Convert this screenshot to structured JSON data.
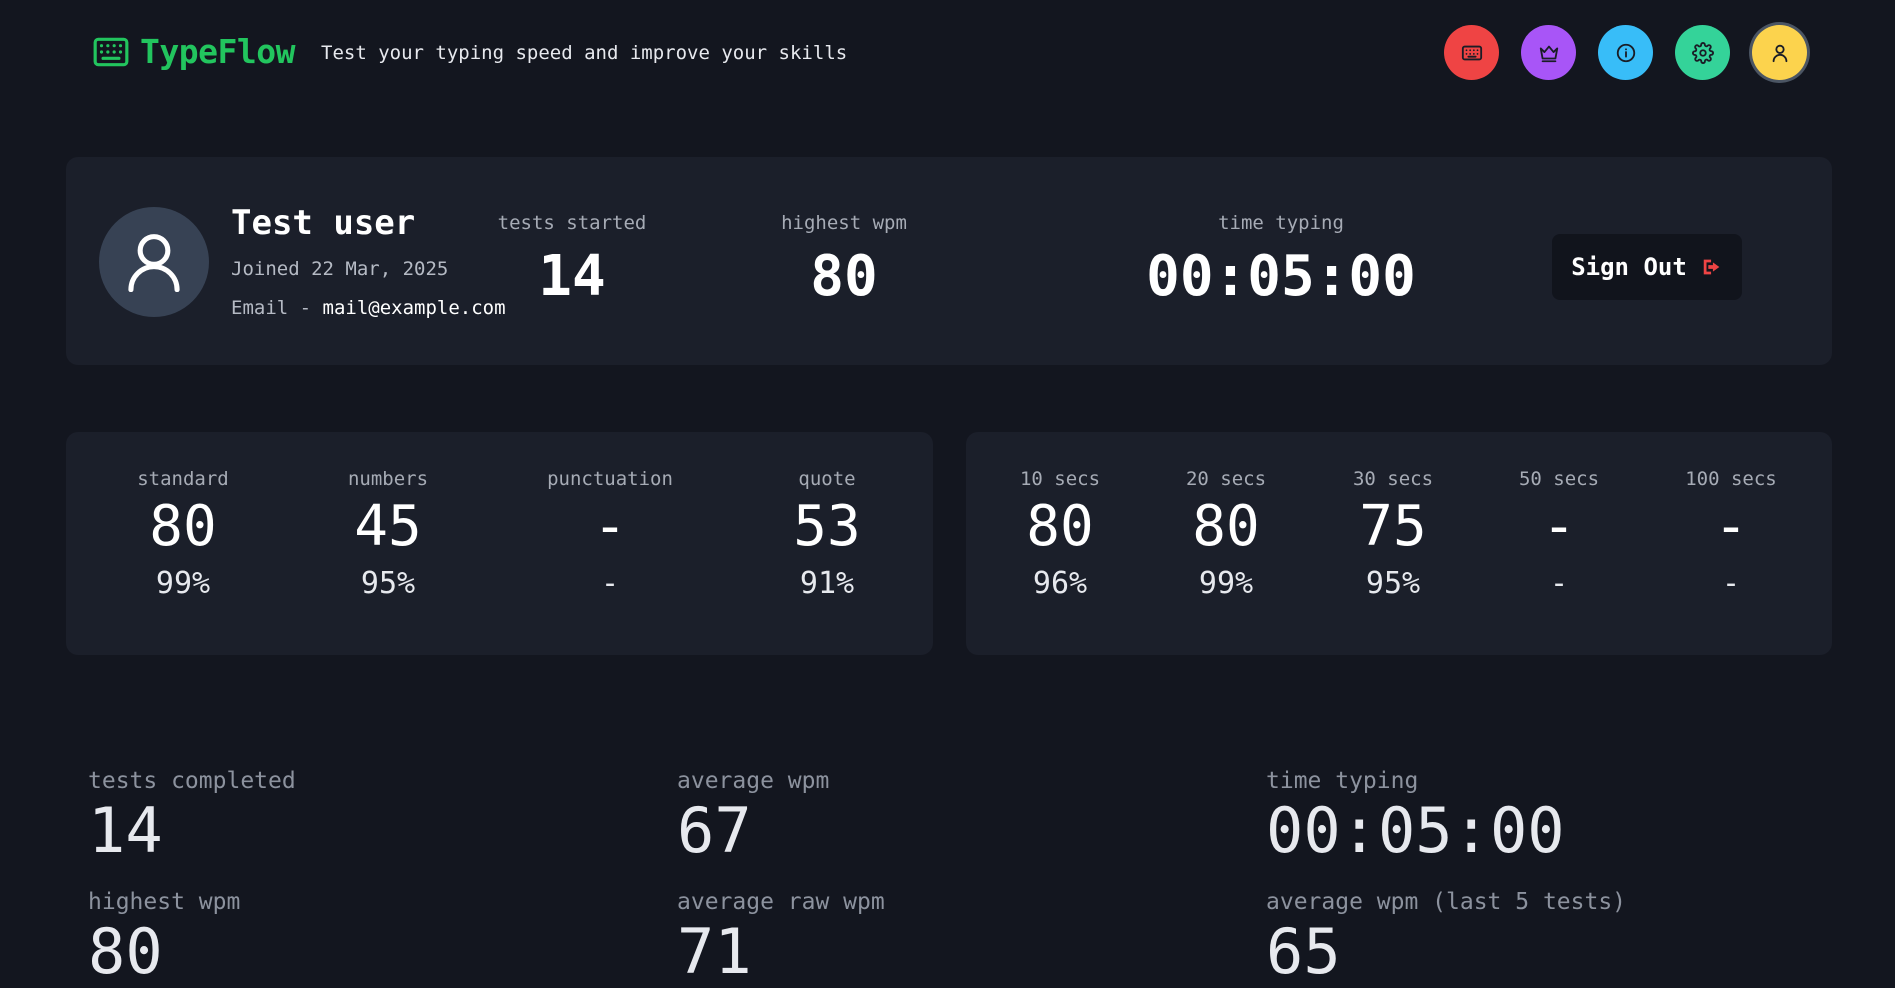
{
  "header": {
    "app_name": "TypeFlow",
    "tagline": "Test your typing speed and improve your skills",
    "nav": [
      {
        "name": "keyboard",
        "icon": "keyboard-icon",
        "color": "#ef4444"
      },
      {
        "name": "leaderboard",
        "icon": "crown-icon",
        "color": "#a855f7"
      },
      {
        "name": "about",
        "icon": "info-icon",
        "color": "#38bdf8"
      },
      {
        "name": "settings",
        "icon": "gear-icon",
        "color": "#34d399"
      },
      {
        "name": "account",
        "icon": "user-icon",
        "color": "#fcd34d"
      }
    ]
  },
  "profile": {
    "name": "Test user",
    "joined": "Joined 22 Mar, 2025",
    "email_prefix": "Email - ",
    "email": "mail@example.com",
    "stats": [
      {
        "label": "tests started",
        "value": "14"
      },
      {
        "label": "highest wpm",
        "value": "80"
      },
      {
        "label": "time typing",
        "value": "00:05:00"
      }
    ],
    "sign_out_label": "Sign Out"
  },
  "records_modes": [
    {
      "label": "standard",
      "wpm": "80",
      "acc": "99%"
    },
    {
      "label": "numbers",
      "wpm": "45",
      "acc": "95%"
    },
    {
      "label": "punctuation",
      "wpm": "-",
      "acc": "-"
    },
    {
      "label": "quote",
      "wpm": "53",
      "acc": "91%"
    }
  ],
  "records_time": [
    {
      "label": "10 secs",
      "wpm": "80",
      "acc": "96%"
    },
    {
      "label": "20 secs",
      "wpm": "80",
      "acc": "99%"
    },
    {
      "label": "30 secs",
      "wpm": "75",
      "acc": "95%"
    },
    {
      "label": "50 secs",
      "wpm": "-",
      "acc": "-"
    },
    {
      "label": "100 secs",
      "wpm": "-",
      "acc": "-"
    }
  ],
  "summary": [
    {
      "label": "tests completed",
      "value": "14"
    },
    {
      "label": "average wpm",
      "value": "67"
    },
    {
      "label": "time typing",
      "value": "00:05:00"
    },
    {
      "label": "highest wpm",
      "value": "80"
    },
    {
      "label": "average raw wpm",
      "value": "71"
    },
    {
      "label": "average wpm (last 5 tests)",
      "value": "65"
    }
  ]
}
